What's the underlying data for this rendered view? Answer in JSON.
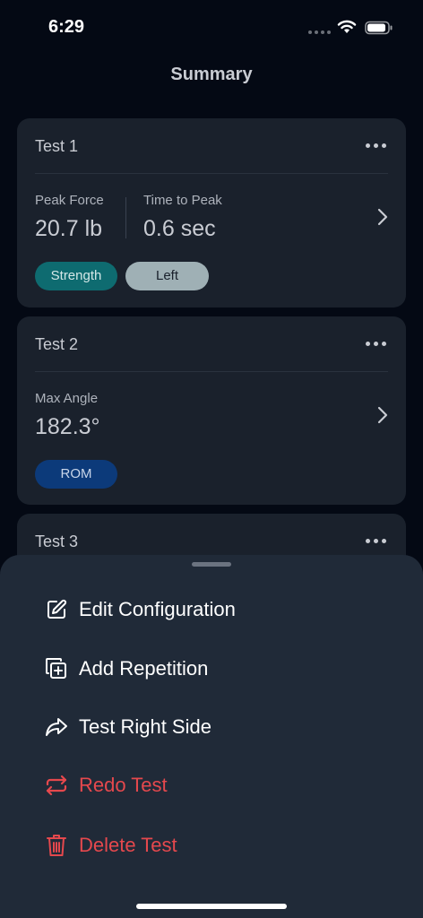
{
  "status_bar": {
    "time": "6:29"
  },
  "nav": {
    "title": "Summary"
  },
  "cards": [
    {
      "title": "Test 1",
      "metrics": [
        {
          "label": "Peak Force",
          "value": "20.7 lb"
        },
        {
          "label": "Time to Peak",
          "value": "0.6 sec"
        }
      ],
      "chips": [
        {
          "label": "Strength",
          "bg": "#0e6b70",
          "color": "#d5e8e8"
        },
        {
          "label": "Left",
          "bg": "#9fb0b5",
          "color": "#1a212c"
        }
      ]
    },
    {
      "title": "Test 2",
      "metrics": [
        {
          "label": "Max Angle",
          "value": "182.3°"
        }
      ],
      "chips": [
        {
          "label": "ROM",
          "bg": "#0c3a7a",
          "color": "#c9d6ea"
        }
      ]
    },
    {
      "title": "Test 3"
    }
  ],
  "sheet": {
    "actions": [
      {
        "label": "Edit Configuration",
        "icon": "edit-icon",
        "color": "#ffffff"
      },
      {
        "label": "Add Repetition",
        "icon": "add-copy-icon",
        "color": "#ffffff"
      },
      {
        "label": "Test Right Side",
        "icon": "share-arrow-icon",
        "color": "#ffffff"
      },
      {
        "label": "Redo Test",
        "icon": "repeat-icon",
        "color": "#e5484d"
      },
      {
        "label": "Delete Test",
        "icon": "trash-icon",
        "color": "#e5484d"
      }
    ]
  }
}
